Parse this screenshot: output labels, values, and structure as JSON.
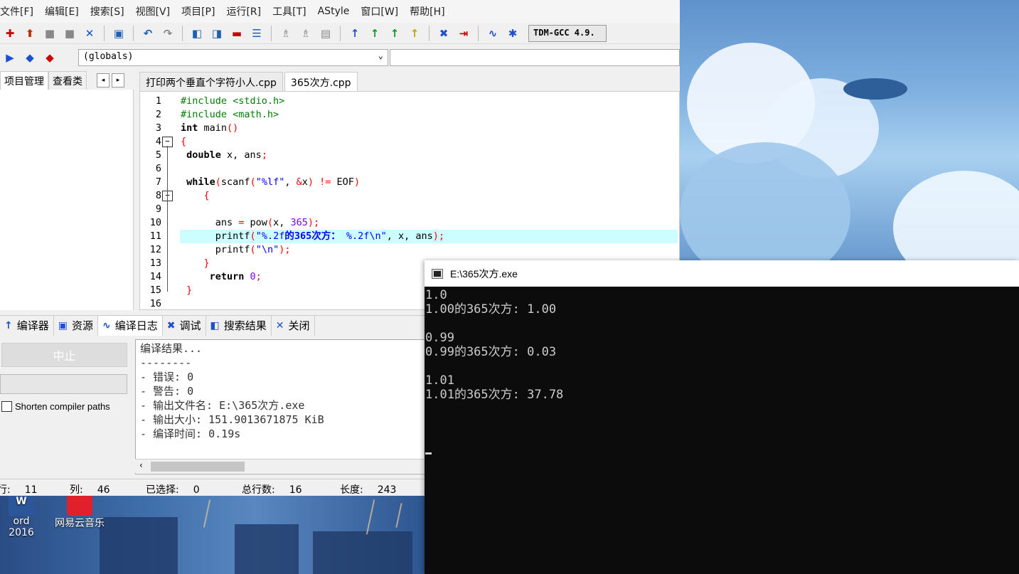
{
  "menu": [
    "文件[F]",
    "编辑[E]",
    "搜索[S]",
    "视图[V]",
    "项目[P]",
    "运行[R]",
    "工具[T]",
    "AStyle",
    "窗口[W]",
    "帮助[H]"
  ],
  "toolbar": {
    "compiler": "TDM-GCC 4.9."
  },
  "scope_combo": {
    "value": "(globals)"
  },
  "left_tabs": {
    "project": "项目管理",
    "classes": "查看类"
  },
  "editor_tabs": [
    "打印两个垂直个字符小人.cpp",
    "365次方.cpp"
  ],
  "code_lines": [
    {
      "n": "1"
    },
    {
      "n": "2"
    },
    {
      "n": "3"
    },
    {
      "n": "4"
    },
    {
      "n": "5"
    },
    {
      "n": "6"
    },
    {
      "n": "7"
    },
    {
      "n": "8"
    },
    {
      "n": "9"
    },
    {
      "n": "10"
    },
    {
      "n": "11"
    },
    {
      "n": "12"
    },
    {
      "n": "13"
    },
    {
      "n": "14"
    },
    {
      "n": "15"
    },
    {
      "n": "16"
    }
  ],
  "code": {
    "l1": "#include <stdio.h>",
    "l2": "#include <math.h>",
    "l3_kw": "int",
    "l3_rest": " main",
    "l3_paren": "()",
    "l4": "{",
    "l5_kw": " double",
    "l5_rest": " x, ans",
    "l5_semi": ";",
    "l7_kw": " while",
    "l7_p1": "(",
    "l7_fn": "scanf",
    "l7_p2": "(",
    "l7_str": "\"%lf\"",
    "l7_c": ", ",
    "l7_amp": "&",
    "l7_x": "x",
    "l7_p3": ")",
    "l7_ne": " != ",
    "l7_eof": "EOF",
    "l7_p4": ")",
    "l8": "    {",
    "l10_a": "      ans ",
    "l10_eq": "=",
    "l10_fn": " pow",
    "l10_p1": "(",
    "l10_x": "x, ",
    "l10_n": "365",
    "l10_p2": ")",
    "l10_s": ";",
    "l11_fn": "      printf",
    "l11_p1": "(",
    "l11_str1": "\"%.2f",
    "l11_cn": "的365次方：",
    "l11_str2": " %.2f\\n\"",
    "l11_rest": ", x, ans",
    "l11_p2": ")",
    "l11_s": ";",
    "l12_fn": "      printf",
    "l12_p1": "(",
    "l12_str": "\"\\n\"",
    "l12_p2": ")",
    "l12_s": ";",
    "l13": "    }",
    "l14_kw": "     return",
    "l14_n": " 0",
    "l14_s": ";",
    "l15": " }"
  },
  "bottom_tabs": [
    "编译器",
    "资源",
    "编译日志",
    "调试",
    "搜索结果",
    "关闭"
  ],
  "stop_button": "中止",
  "shorten_label": "Shorten compiler paths",
  "compile_log": [
    "编译结果...",
    "--------",
    "- 错误: 0",
    "- 警告: 0",
    "- 输出文件名: E:\\365次方.exe",
    "- 输出大小: 151.9013671875 KiB",
    "- 编译时间: 0.19s"
  ],
  "status": {
    "row_label": "行:",
    "row": "11",
    "col_label": "列:",
    "col": "46",
    "sel_label": "已选择:",
    "sel": "0",
    "total_label": "总行数:",
    "total": "16",
    "len_label": "长度:",
    "len": "243"
  },
  "console": {
    "title": "E:\\365次方.exe",
    "lines": [
      "1.0",
      "1.00的365次方: 1.00",
      "",
      "0.99",
      "0.99的365次方: 0.03",
      "",
      "1.01",
      "1.01的365次方: 37.78"
    ]
  },
  "desktop_icons": [
    "ord 2016",
    "网易云音乐"
  ]
}
